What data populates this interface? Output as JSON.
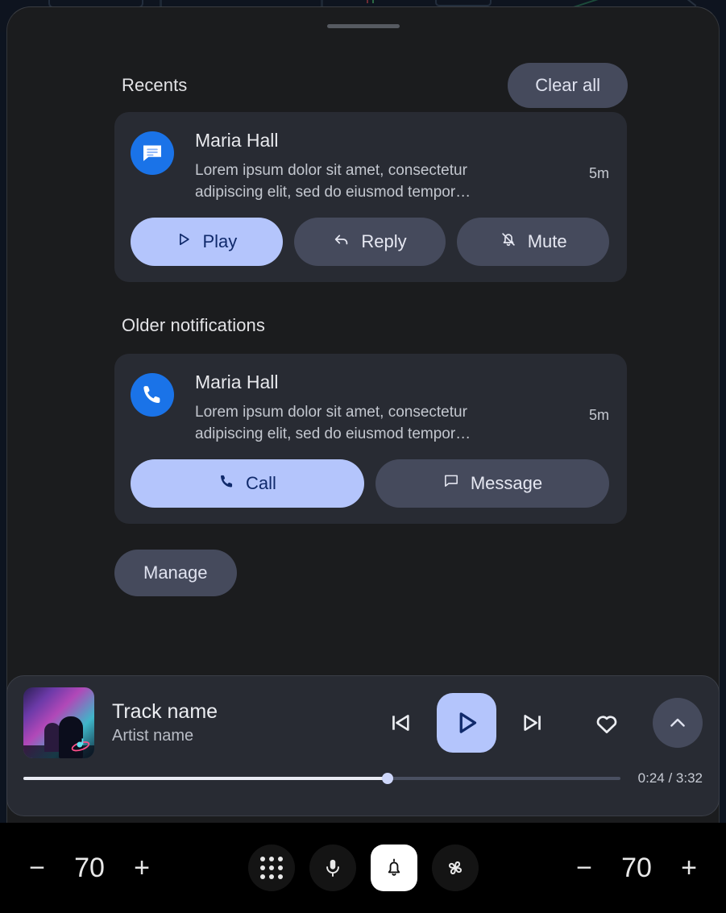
{
  "panel": {
    "drag_handle": "drag-handle"
  },
  "recents": {
    "title": "Recents",
    "clear_all_label": "Clear all",
    "notification": {
      "app_icon": "messages-icon",
      "sender": "Maria Hall",
      "body": "Lorem ipsum dolor sit amet, consectetur adipiscing elit, sed do eiusmod tempor…",
      "time": "5m",
      "actions": [
        {
          "label": "Play",
          "icon": "play-icon",
          "style": "primary"
        },
        {
          "label": "Reply",
          "icon": "reply-icon",
          "style": "secondary"
        },
        {
          "label": "Mute",
          "icon": "bell-off-icon",
          "style": "secondary"
        }
      ]
    }
  },
  "older": {
    "title": "Older notifications",
    "notification": {
      "app_icon": "phone-icon",
      "sender": "Maria Hall",
      "body": "Lorem ipsum dolor sit amet, consectetur adipiscing elit, sed do eiusmod tempor…",
      "time": "5m",
      "actions": [
        {
          "label": "Call",
          "icon": "phone-icon",
          "style": "primary"
        },
        {
          "label": "Message",
          "icon": "message-icon",
          "style": "secondary"
        }
      ]
    }
  },
  "manage": {
    "label": "Manage"
  },
  "media": {
    "album_art": "album-art-concert",
    "track_name": "Track name",
    "artist_name": "Artist name",
    "controls": {
      "previous": "skip-previous-icon",
      "play": "play-icon",
      "next": "skip-next-icon",
      "favorite": "heart-icon",
      "expand": "chevron-up-icon"
    },
    "progress": {
      "elapsed": "0:24",
      "duration": "3:32",
      "time_label": "0:24 / 3:32",
      "percent": 61
    }
  },
  "system_bar": {
    "left_volume": {
      "minus": "−",
      "value": "70",
      "plus": "+"
    },
    "right_volume": {
      "minus": "−",
      "value": "70",
      "plus": "+"
    },
    "center_icons": [
      {
        "name": "app-grid-icon",
        "active": false
      },
      {
        "name": "microphone-icon",
        "active": false
      },
      {
        "name": "notifications-bell-icon",
        "active": true
      },
      {
        "name": "climate-fan-icon",
        "active": false
      }
    ]
  },
  "colors": {
    "panel_bg": "#1b1c1e",
    "card_bg": "#282b33",
    "accent": "#b4c5fc",
    "accent_text": "#102a6b",
    "secondary_btn": "#454a5c",
    "app_blue": "#1a73e8",
    "system_bar_bg": "#000000"
  }
}
